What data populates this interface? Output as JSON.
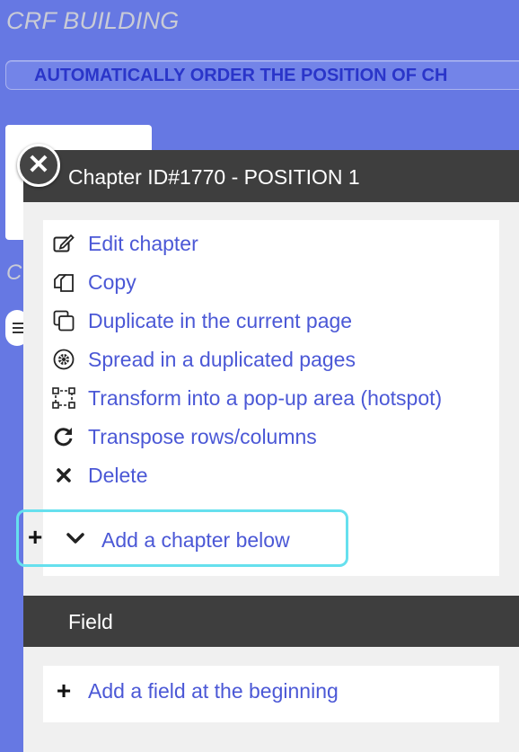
{
  "app": {
    "title": "CRF BUILDING"
  },
  "toolbar": {
    "auto_order_label": "AUTOMATICALLY ORDER THE POSITION OF CH"
  },
  "sidebar": {
    "partial_letter": "C"
  },
  "chapter": {
    "header": "Chapter ID#1770 - POSITION 1",
    "menu": [
      {
        "label": "Edit chapter",
        "icon": "edit-icon"
      },
      {
        "label": "Copy",
        "icon": "copy-icon"
      },
      {
        "label": "Duplicate in the current page",
        "icon": "duplicate-icon"
      },
      {
        "label": "Spread in a duplicated pages",
        "icon": "spread-icon"
      },
      {
        "label": "Transform into a pop-up area (hotspot)",
        "icon": "hotspot-icon"
      },
      {
        "label": "Transpose rows/columns",
        "icon": "transpose-icon"
      },
      {
        "label": "Delete",
        "icon": "delete-icon"
      }
    ],
    "add_below_label": "Add a chapter below"
  },
  "field": {
    "header": "Field",
    "add_label": "Add a field at the beginning"
  },
  "colors": {
    "background": "#6678e3",
    "link": "#4b58d6",
    "header": "#3e3e3e",
    "highlight": "#66e0ee"
  }
}
